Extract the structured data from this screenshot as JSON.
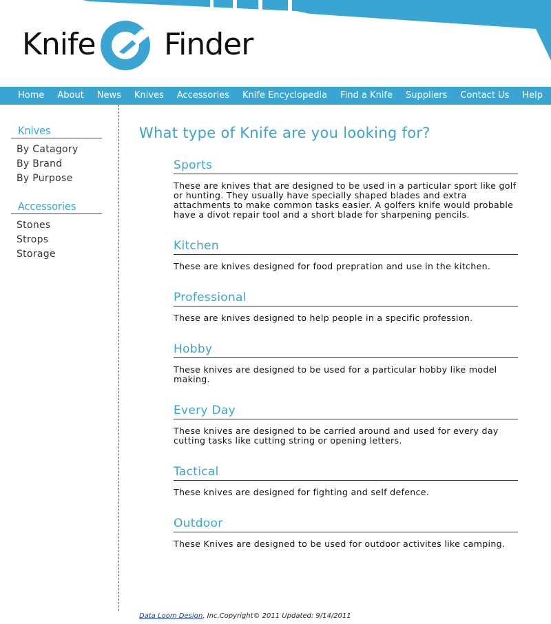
{
  "brand": {
    "name_left": "Knife",
    "name_right": "Finder",
    "accent": "#3aa4d2"
  },
  "nav": [
    "Home",
    "About",
    "News",
    "Knives",
    "Accessories",
    "Knife Encyclopedia",
    "Find a Knife",
    "Suppliers",
    "Contact Us",
    "Help"
  ],
  "sidebar": {
    "knives": {
      "title": "Knives",
      "items": [
        "By Catagory",
        "By Brand",
        "By Purpose"
      ]
    },
    "accessories": {
      "title": "Accessories",
      "items": [
        "Stones",
        "Strops",
        "Storage"
      ]
    }
  },
  "main": {
    "title": "What type of Knife are you looking for?",
    "sections": [
      {
        "title": "Sports",
        "body": "These are knives that are designed to be used in a particular sport like golf or hunting. They usually have specially shaped blades and extra attachments to make common tasks easier. A golfers knife would probable have a divot repair tool and a short blade for sharpening pencils."
      },
      {
        "title": "Kitchen",
        "body": "These are knives designed for food prepration and use in the kitchen."
      },
      {
        "title": "Professional",
        "body": "These are knives designed to help people in a specific profession."
      },
      {
        "title": "Hobby",
        "body": "These knives are designed to be used for a particular hobby like model making."
      },
      {
        "title": "Every Day",
        "body": "These knives are designed to be carried around and used for every day cutting tasks like cutting string or opening letters."
      },
      {
        "title": "Tactical",
        "body": "These knives are designed for fighting and self defence."
      },
      {
        "title": "Outdoor",
        "body": "These Knives are designed to be used for outdoor activites like camping."
      }
    ]
  },
  "footer": {
    "link": "Data Loom Design",
    "text": ", Inc.Copyright© 2011 Updated: 9/14/2011"
  }
}
